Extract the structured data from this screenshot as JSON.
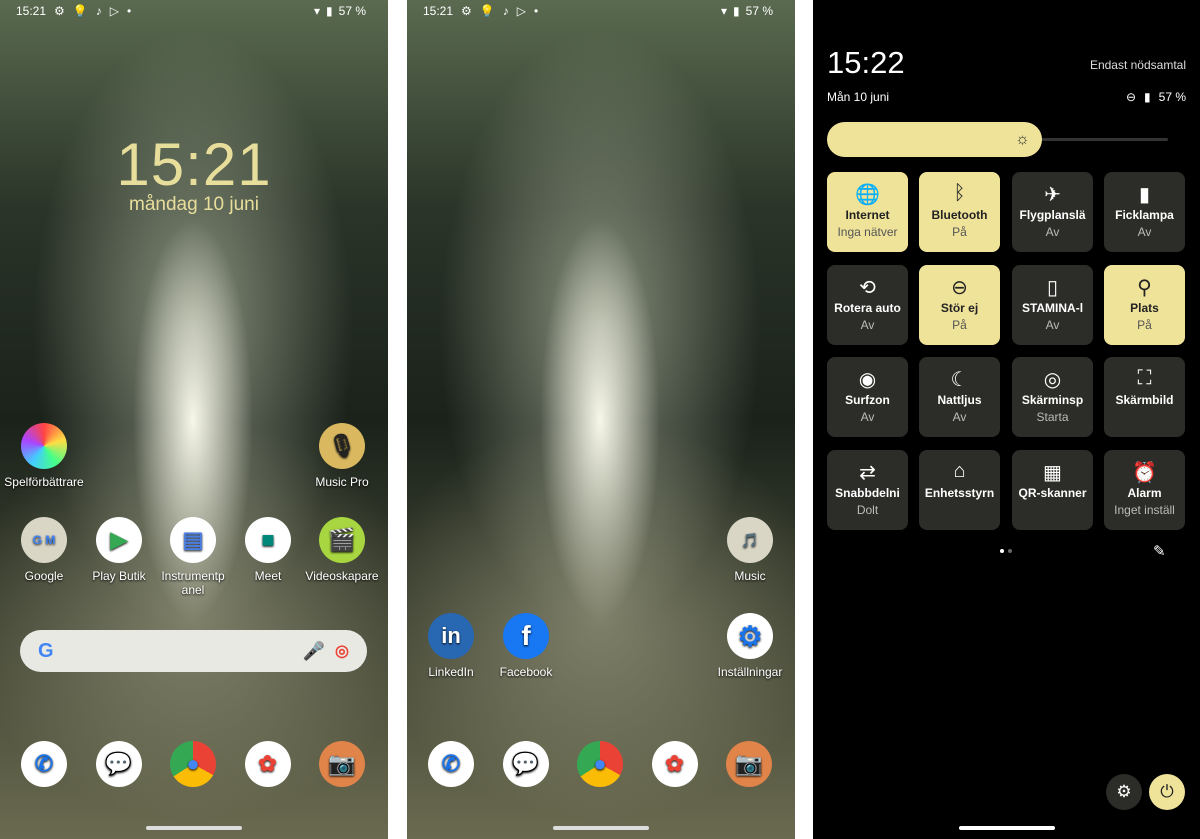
{
  "home1": {
    "status": {
      "time": "15:21",
      "battery": "57 %"
    },
    "clock": "15:21",
    "date": "måndag 10 juni",
    "apps": [
      {
        "label": "Spelförbättrare",
        "icon": "game-enhancer-icon"
      },
      {
        "label": "Music Pro",
        "icon": "microphone-icon"
      },
      {
        "label": "Google",
        "icon": "google-folder-icon"
      },
      {
        "label": "Play Butik",
        "icon": "play-store-icon"
      },
      {
        "label": "Instrumentpanel",
        "icon": "dashboard-icon"
      },
      {
        "label": "Meet",
        "icon": "meet-icon"
      },
      {
        "label": "Videoskapare",
        "icon": "clapperboard-icon"
      }
    ],
    "search": {
      "logo": "G"
    }
  },
  "home2": {
    "status": {
      "time": "15:21",
      "battery": "57 %"
    },
    "apps": [
      {
        "label": "Music",
        "icon": "music-folder-icon"
      },
      {
        "label": "LinkedIn",
        "icon": "linkedin-icon"
      },
      {
        "label": "Facebook",
        "icon": "facebook-icon"
      },
      {
        "label": "Inställningar",
        "icon": "settings-icon"
      }
    ]
  },
  "dock": [
    "phone",
    "messages",
    "chrome",
    "photos",
    "camera"
  ],
  "quick": {
    "time": "15:22",
    "date": "Mån 10 juni",
    "carrier": "Endast nödsamtal",
    "battery": "57 %",
    "brightness": 0.62,
    "accent": "#efe39a",
    "tiles": [
      {
        "label": "Internet",
        "state": "Inga nätver",
        "on": true,
        "icon": "globe-off-icon",
        "g": "🌐"
      },
      {
        "label": "Bluetooth",
        "state": "På",
        "on": true,
        "icon": "bluetooth-icon",
        "g": "ᛒ"
      },
      {
        "label": "Flygplanslä",
        "state": "Av",
        "on": false,
        "icon": "airplane-icon",
        "g": "✈"
      },
      {
        "label": "Ficklampa",
        "state": "Av",
        "on": false,
        "icon": "flashlight-icon",
        "g": "▮"
      },
      {
        "label": "Rotera auto",
        "state": "Av",
        "on": false,
        "icon": "rotate-icon",
        "g": "⟲"
      },
      {
        "label": "Stör ej",
        "state": "På",
        "on": true,
        "icon": "do-not-disturb-icon",
        "g": "⊖"
      },
      {
        "label": "STAMINA-l",
        "state": "Av",
        "on": false,
        "icon": "battery-plus-icon",
        "g": "▯"
      },
      {
        "label": "Plats",
        "state": "På",
        "on": true,
        "icon": "location-icon",
        "g": "⚲"
      },
      {
        "label": "Surfzon",
        "state": "Av",
        "on": false,
        "icon": "hotspot-icon",
        "g": "◉"
      },
      {
        "label": "Nattljus",
        "state": "Av",
        "on": false,
        "icon": "moon-icon",
        "g": "☾"
      },
      {
        "label": "Skärminsp",
        "state": "Starta",
        "on": false,
        "icon": "screen-record-icon",
        "g": "◎"
      },
      {
        "label": "Skärmbild",
        "state": "",
        "on": false,
        "icon": "screenshot-icon",
        "g": "⛶"
      },
      {
        "label": "Snabbdelni",
        "state": "Dolt",
        "on": false,
        "icon": "quick-share-icon",
        "g": "⇄"
      },
      {
        "label": "Enhetsstyrn",
        "state": "",
        "on": false,
        "icon": "home-icon",
        "g": "⌂"
      },
      {
        "label": "QR-skanner",
        "state": "",
        "on": false,
        "icon": "qr-code-icon",
        "g": "▦"
      },
      {
        "label": "Alarm",
        "state": "Inget inställ",
        "on": false,
        "icon": "alarm-icon",
        "g": "⏰"
      }
    ]
  }
}
